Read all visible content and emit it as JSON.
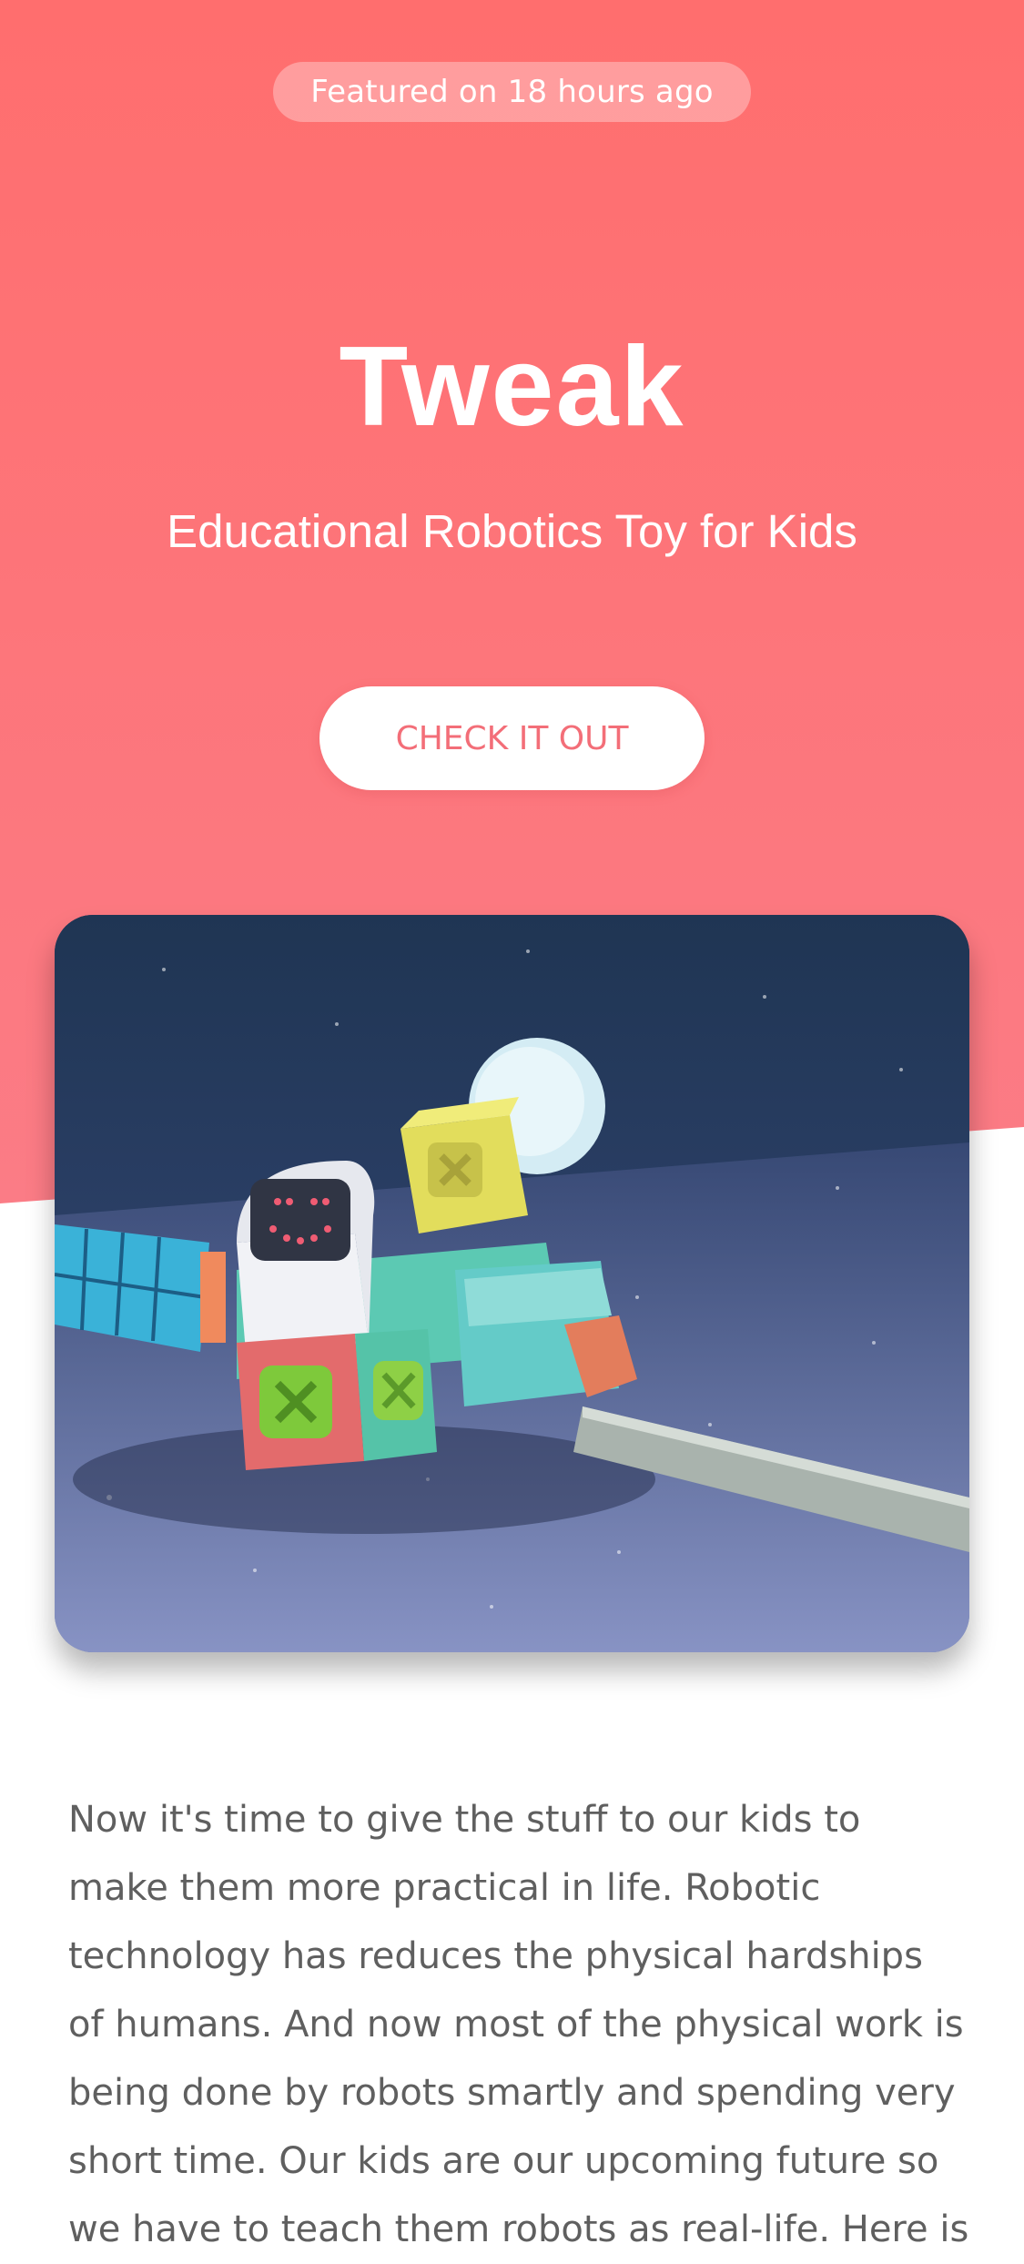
{
  "badge": {
    "text": "Featured on 18 hours ago"
  },
  "hero": {
    "title": "Tweak",
    "subtitle": "Educational Robotics Toy for Kids",
    "cta_label": "CHECK IT OUT"
  },
  "description": {
    "text": "Now it's time to give the stuff to our kids to make them more practical in life. Robotic technology has reduces the physical hardships of humans. And now most of the physical work is being done by robots smartly and spending very short time. Our kids are our upcoming future so we have to teach them robots as real-life. Here is"
  },
  "colors": {
    "hero_gradient_top": "#ff6e6e",
    "hero_gradient_bottom": "#fb7c86",
    "cta_text": "#f36e78",
    "body_text": "#5f5f5f"
  }
}
